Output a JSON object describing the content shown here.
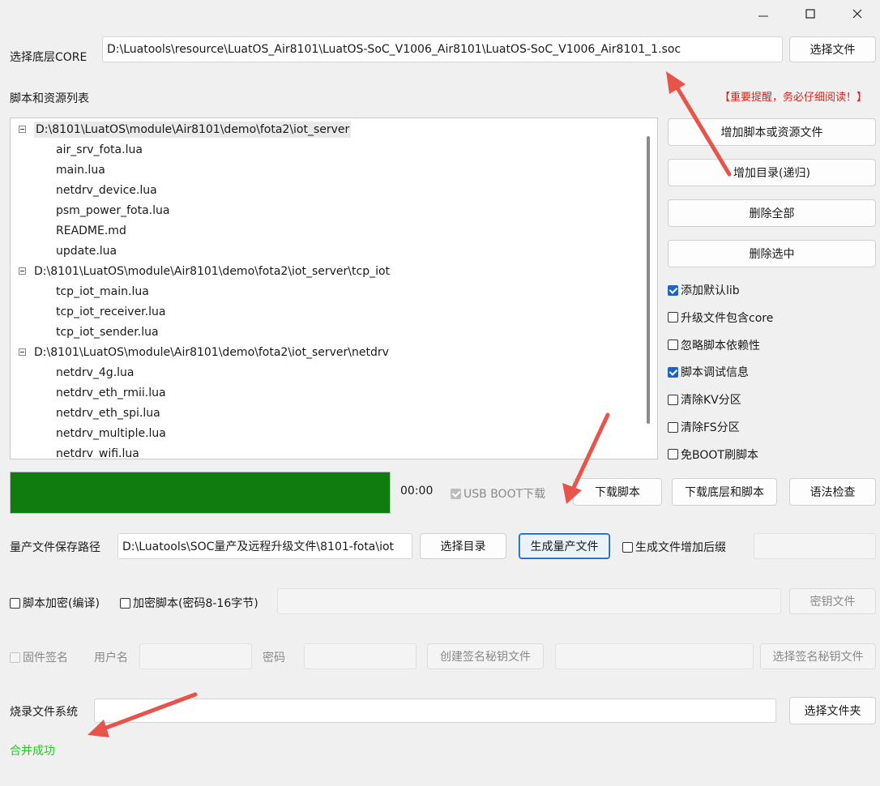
{
  "window": {
    "controls": [
      "minimize",
      "maximize",
      "close"
    ]
  },
  "core": {
    "label": "选择底层CORE",
    "path": "D:\\Luatools\\resource\\LuatOS_Air8101\\LuatOS-SoC_V1006_Air8101\\LuatOS-SoC_V1006_Air8101_1.soc",
    "button": "选择文件"
  },
  "scripts": {
    "label": "脚本和资源列表",
    "warning": "【重要提醒，务必仔细阅读！】",
    "tree": [
      {
        "type": "node",
        "text": "D:\\8101\\LuatOS\\module\\Air8101\\demo\\fota2\\iot_server"
      },
      {
        "type": "leaf",
        "text": "air_srv_fota.lua"
      },
      {
        "type": "leaf",
        "text": "main.lua"
      },
      {
        "type": "leaf",
        "text": "netdrv_device.lua"
      },
      {
        "type": "leaf",
        "text": "psm_power_fota.lua"
      },
      {
        "type": "leaf",
        "text": "README.md"
      },
      {
        "type": "leaf",
        "text": "update.lua"
      },
      {
        "type": "node",
        "text": "D:\\8101\\LuatOS\\module\\Air8101\\demo\\fota2\\iot_server\\tcp_iot"
      },
      {
        "type": "leaf",
        "text": "tcp_iot_main.lua"
      },
      {
        "type": "leaf",
        "text": "tcp_iot_receiver.lua"
      },
      {
        "type": "leaf",
        "text": "tcp_iot_sender.lua"
      },
      {
        "type": "node",
        "text": "D:\\8101\\LuatOS\\module\\Air8101\\demo\\fota2\\iot_server\\netdrv"
      },
      {
        "type": "leaf",
        "text": "netdrv_4g.lua"
      },
      {
        "type": "leaf",
        "text": "netdrv_eth_rmii.lua"
      },
      {
        "type": "leaf",
        "text": "netdrv_eth_spi.lua"
      },
      {
        "type": "leaf",
        "text": "netdrv_multiple.lua"
      },
      {
        "type": "leaf",
        "text": "netdrv_wifi.lua"
      }
    ],
    "buttons": {
      "add_file": "增加脚本或资源文件",
      "add_dir": "增加目录(递归)",
      "delete_all": "删除全部",
      "delete_selected": "删除选中"
    },
    "options": [
      {
        "label": "添加默认lib",
        "checked": true
      },
      {
        "label": "升级文件包含core",
        "checked": false
      },
      {
        "label": "忽略脚本依赖性",
        "checked": false
      },
      {
        "label": "脚本调试信息",
        "checked": true
      },
      {
        "label": "清除KV分区",
        "checked": false
      },
      {
        "label": "清除FS分区",
        "checked": false
      },
      {
        "label": "免BOOT刷脚本",
        "checked": false
      }
    ]
  },
  "download": {
    "progress": 1.0,
    "progress_color": "#107c10",
    "time": "00:00",
    "usb_boot_label": "USB BOOT下载",
    "usb_boot_checked": true,
    "download_script": "下载脚本",
    "download_core_and_script": "下载底层和脚本",
    "syntax_check": "语法检查"
  },
  "mass": {
    "label": "量产文件保存路径",
    "path": "D:\\Luatools\\SOC量产及远程升级文件\\8101-fota\\iot",
    "choose_dir": "选择目录",
    "generate": "生成量产文件",
    "suffix_label": "生成文件增加后缀",
    "suffix_checked": false,
    "suffix_value": ""
  },
  "encrypt": {
    "compile_label": "脚本加密(编译)",
    "password_label": "加密脚本(密码8-16字节)",
    "password_value": "",
    "key_file": "密钥文件"
  },
  "sign": {
    "label": "固件签名",
    "user_label": "用户名",
    "password_label": "密码",
    "create_key": "创建签名秘钥文件",
    "select_key": "选择签名秘钥文件"
  },
  "fs": {
    "label": "烧录文件系统",
    "value": "",
    "button": "选择文件夹"
  },
  "status": {
    "text": "合并成功",
    "color": "#22cc22"
  },
  "annotation_color": "#e8534a"
}
